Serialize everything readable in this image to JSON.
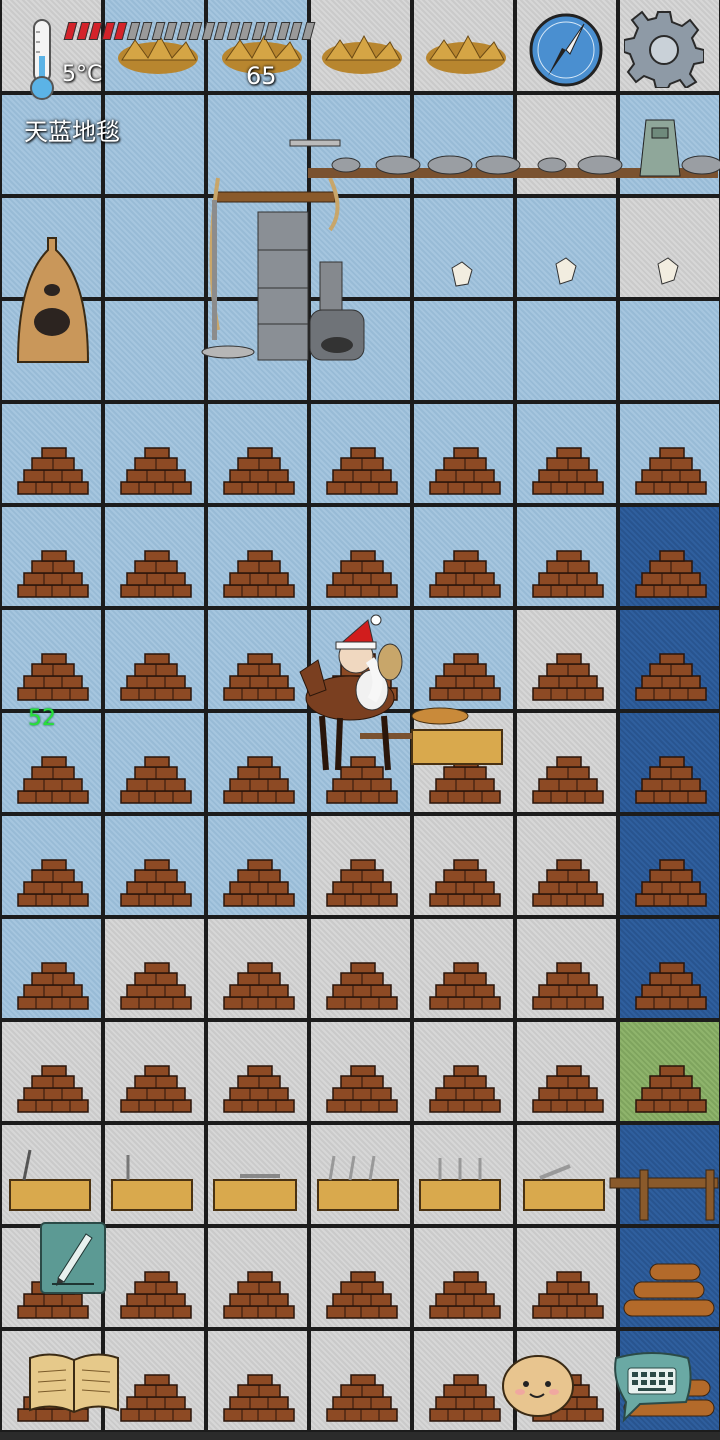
{
  "hud": {
    "temperature": "5°C",
    "food_value": "65",
    "location": "天蓝地毯",
    "age": "52",
    "food_pips_total": 20,
    "food_pips_filled": 5,
    "food_fill_color": "#d4232a",
    "food_empty_color": "#9a9a9a"
  },
  "tile_colors": {
    "g": "#d2d2d2",
    "b": "#a3c3dc",
    "d": "#2c5a98",
    "n": "#88ad66"
  },
  "tile_rows": [
    "gbbgggg",
    "bbbbbgb",
    "bbbbbbg",
    "bbbbbbb",
    "bbbbbbb",
    "bbbbbbd",
    "bbbbbgd",
    "bbbbggd",
    "bbbgggd",
    "bgggggd",
    "ggggggn",
    "ggggggd",
    "ggggggd",
    "ggggggd"
  ],
  "icons": {
    "thermometer": "thermometer-icon",
    "compass": "compass-icon",
    "settings": "gear-icon",
    "pencil": "pencil-icon",
    "recipe_book": "book-icon",
    "emote": "emote-face-icon",
    "chat": "keyboard-chat-icon"
  }
}
